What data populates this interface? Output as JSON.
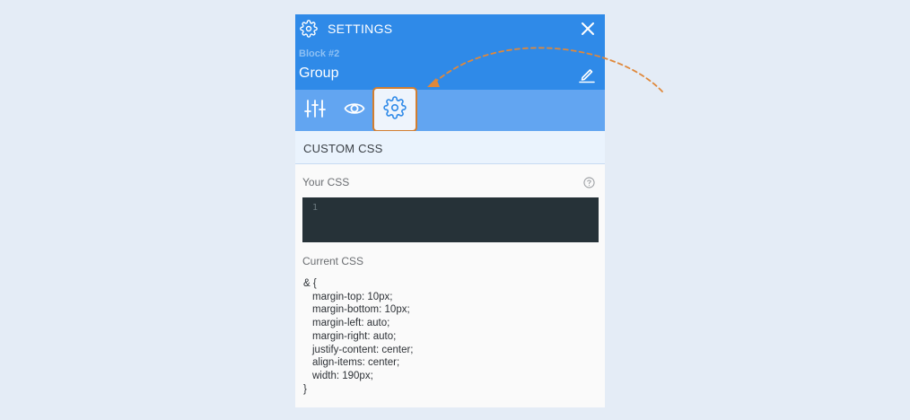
{
  "header": {
    "title": "SETTINGS",
    "block_label": "Block #2",
    "block_name": "Group",
    "icons": [
      "gear-icon",
      "close-icon",
      "edit-icon"
    ]
  },
  "tabs": [
    {
      "icon": "sliders-icon"
    },
    {
      "icon": "eye-icon"
    },
    {
      "icon": "gear-icon",
      "selected": true
    }
  ],
  "section": {
    "title": "CUSTOM CSS"
  },
  "your_css": {
    "label": "Your CSS",
    "line_number": "1",
    "value": ""
  },
  "current_css": {
    "label": "Current CSS",
    "open": "& {",
    "lines": [
      "margin-top: 10px;",
      "margin-bottom: 10px;",
      "margin-left: auto;",
      "margin-right: auto;",
      "justify-content: center;",
      "align-items: center;",
      "width: 190px;"
    ],
    "close": "}"
  },
  "colors": {
    "header_bg": "#2f8ae8",
    "tabs_bg": "#62a5f1",
    "highlight": "#d27e30",
    "editor_bg": "#263238",
    "page_bg": "#e4ecf6"
  }
}
